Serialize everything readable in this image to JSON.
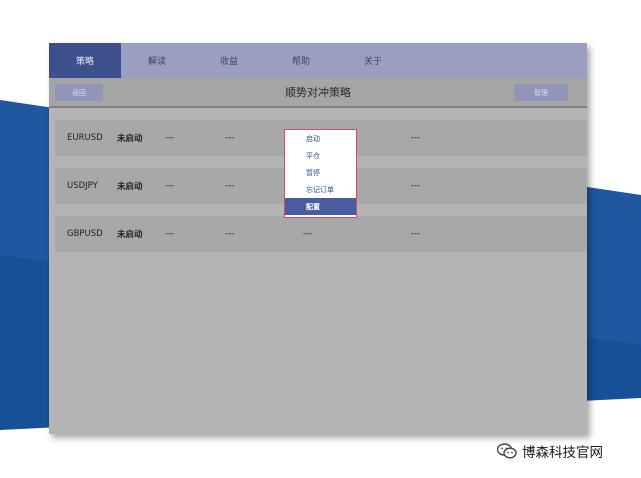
{
  "tabs": [
    {
      "label": "策略",
      "active": true
    },
    {
      "label": "解读",
      "active": false
    },
    {
      "label": "收益",
      "active": false
    },
    {
      "label": "帮助",
      "active": false
    },
    {
      "label": "关于",
      "active": false
    }
  ],
  "toolbar": {
    "back_label": "返回",
    "title": "顺势对冲策略",
    "manage_label": "管理"
  },
  "rows": [
    {
      "symbol": "EURUSD",
      "status": "未启动",
      "c1": "---",
      "c2": "---",
      "c3": "",
      "c4": "---"
    },
    {
      "symbol": "USDJPY",
      "status": "未启动",
      "c1": "---",
      "c2": "---",
      "c3": "",
      "c4": "---"
    },
    {
      "symbol": "GBPUSD",
      "status": "未启动",
      "c1": "---",
      "c2": "---",
      "c3": "---",
      "c4": "---"
    }
  ],
  "context_menu": {
    "items": [
      "启动",
      "平仓",
      "暂停",
      "忘记订单",
      "配置"
    ],
    "selected": "配置"
  },
  "watermark": {
    "text": "博森科技官网",
    "icon": "wechat-icon"
  },
  "colors": {
    "tab_active": "#3e4f8d",
    "tab_bar": "#9a9fc2",
    "panel": "#b4b4b4",
    "menu_border": "#d9485c",
    "menu_selected": "#4a5c9e",
    "background_blue": "#1f57a0"
  }
}
